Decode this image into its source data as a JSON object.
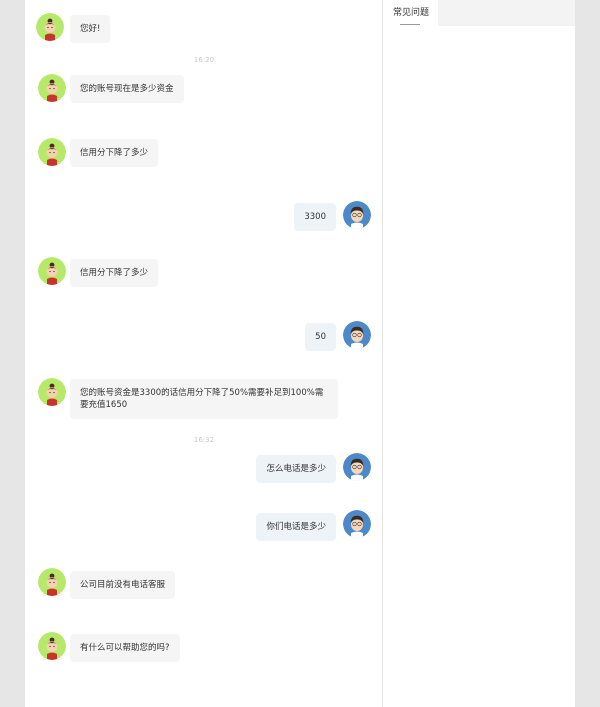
{
  "faq": {
    "tab_label": "常见问题"
  },
  "timestamps": [
    "16:20",
    "16:32"
  ],
  "messages": [
    {
      "side": "agent",
      "text": "您好!"
    },
    {
      "side": "agent",
      "text": "您的账号现在是多少资金"
    },
    {
      "side": "agent",
      "text": "信用分下降了多少"
    },
    {
      "side": "user",
      "text": "3300"
    },
    {
      "side": "agent",
      "text": "信用分下降了多少"
    },
    {
      "side": "user",
      "text": "50"
    },
    {
      "side": "agent",
      "text": "您的账号资金是3300的话信用分下降了50%需要补足到100%需要充值1650"
    },
    {
      "side": "user",
      "text": "怎么电话是多少"
    },
    {
      "side": "user",
      "text": "你们电话是多少"
    },
    {
      "side": "agent",
      "text": "公司目前没有电话客服"
    },
    {
      "side": "agent",
      "text": "有什么可以帮助您的吗?"
    }
  ],
  "colors": {
    "agent_avatar_bg": "#b6e86a",
    "user_avatar_bg": "#4d88c8",
    "agent_bubble": "#f5f5f5",
    "user_bubble": "#eef3f8",
    "page_bg": "#e6e6e6"
  }
}
